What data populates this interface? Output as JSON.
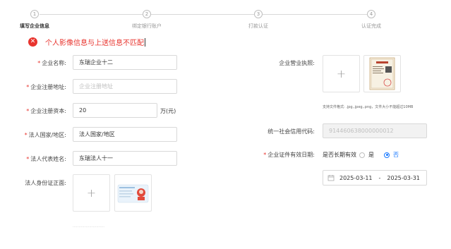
{
  "steps": [
    {
      "num": "1",
      "label": "填写企业信息"
    },
    {
      "num": "2",
      "label": "绑定银行账户"
    },
    {
      "num": "3",
      "label": "打款认证"
    },
    {
      "num": "4",
      "label": "认证完成"
    }
  ],
  "alert": {
    "icon": "error-icon",
    "text": "个人影像信息与上送信息不匹配"
  },
  "form": {
    "company_name": {
      "label": "企业名称:",
      "value": "东瑞企业十二"
    },
    "reg_address": {
      "label": "企业注册地址:",
      "placeholder": "企业注册地址"
    },
    "reg_capital": {
      "label": "企业注册资本:",
      "value": "20",
      "unit": "万(元)"
    },
    "legal_country": {
      "label": "法人国家/地区:",
      "placeholder": "法人国家/地区"
    },
    "legal_name": {
      "label": "法人代表姓名:",
      "value": "东瑞法人十一"
    },
    "id_front": {
      "label": "法人身份证正面:"
    },
    "license": {
      "label": "企业营业执照:",
      "hint": "支持文件格式: .jpg,.jpeg,.png，文件大小不能超过10MB"
    },
    "credit_code": {
      "label": "统一社会信用代码:",
      "value": "914460638000000012"
    },
    "validity": {
      "label": "企业证件有效日期:",
      "question": "是否长期有效",
      "option_yes": "是",
      "option_no": "否",
      "selected": "否",
      "start": "2025-03-11",
      "sep": "-",
      "end": "2025-03-31"
    }
  },
  "colors": {
    "error": "#e8342e",
    "accent": "#1677ff"
  }
}
